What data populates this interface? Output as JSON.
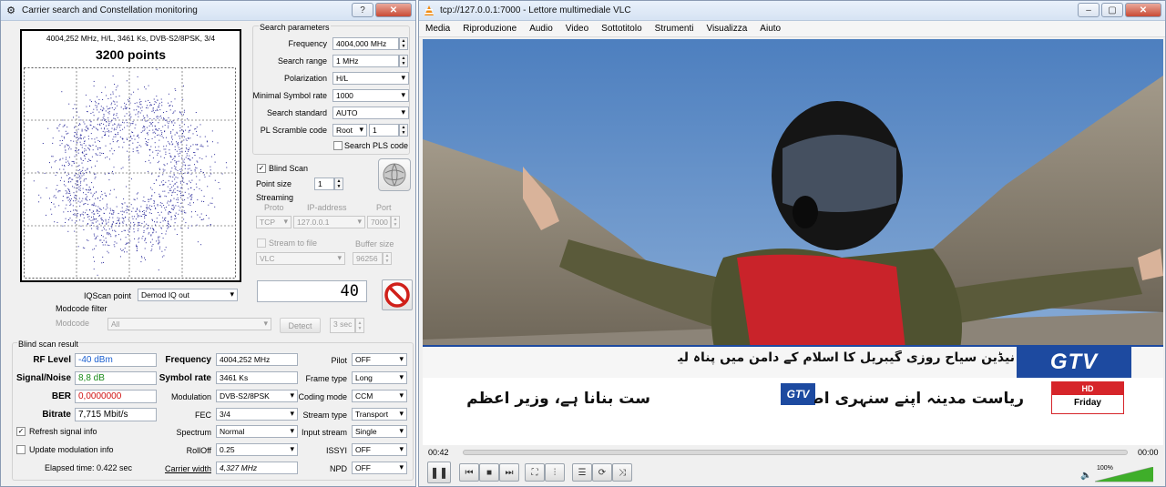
{
  "left_window": {
    "title": "Carrier search and Constellation monitoring",
    "help_btn": "?",
    "close_btn": "✕",
    "constellation": {
      "info": "4004,252 MHz, H/L, 3461 Ks, DVB-S2/8PSK, 3/4",
      "points_label": "3200 points"
    },
    "search_params": {
      "title": "Search parameters",
      "frequency_label": "Frequency",
      "frequency_value": "4004,000 MHz",
      "range_label": "Search range",
      "range_value": "1 MHz",
      "polarization_label": "Polarization",
      "polarization_value": "H/L",
      "min_sr_label": "Minimal Symbol rate",
      "min_sr_value": "1000",
      "standard_label": "Search standard",
      "standard_value": "AUTO",
      "pls_label": "PL Scramble code",
      "pls_mode": "Root",
      "pls_value": "1",
      "search_pls_label": "Search PLS code"
    },
    "blind_scan_label": "Blind Scan",
    "point_size_label": "Point size",
    "point_size_value": "1",
    "streaming": {
      "title": "Streaming",
      "proto_label": "Proto",
      "ip_label": "IP-address",
      "port_label": "Port",
      "proto_value": "TCP",
      "ip_value": "127.0.0.1",
      "port_value": "7000",
      "stream_to_file_label": "Stream to file",
      "buffer_label": "Buffer size",
      "player_value": "VLC",
      "buffer_value": "96256"
    },
    "iq_label": "IQScan point",
    "iq_value": "Demod IQ out",
    "counter_value": "40",
    "modcode": {
      "title": "Modcode filter",
      "label": "Modcode",
      "value": "All",
      "detect_label": "Detect",
      "timeout_value": "3 sec"
    },
    "result": {
      "title": "Blind scan result",
      "rf_label": "RF Level",
      "rf_value": "-40 dBm",
      "sn_label": "Signal/Noise",
      "sn_value": "8,8 dB",
      "ber_label": "BER",
      "ber_value": "0,0000000",
      "bitrate_label": "Bitrate",
      "bitrate_value": "7,715 Mbit/s",
      "freq_label": "Frequency",
      "freq_value": "4004,252 MHz",
      "sr_label": "Symbol rate",
      "sr_value": "3461 Ks",
      "mod_label": "Modulation",
      "mod_value": "DVB-S2/8PSK",
      "fec_label": "FEC",
      "fec_value": "3/4",
      "spectrum_label": "Spectrum",
      "spectrum_value": "Normal",
      "rolloff_label": "RollOff",
      "rolloff_value": "0.25",
      "cw_label": "Carrier width",
      "cw_value": "4,327 MHz",
      "pilot_label": "Pilot",
      "pilot_value": "OFF",
      "frame_label": "Frame type",
      "frame_value": "Long",
      "coding_label": "Coding mode",
      "coding_value": "CCM",
      "stream_label": "Stream type",
      "stream_value": "Transport",
      "input_label": "Input stream",
      "input_value": "Single",
      "issyi_label": "ISSYI",
      "issyi_value": "OFF",
      "npd_label": "NPD",
      "npd_value": "OFF"
    },
    "refresh_label": "Refresh signal info",
    "update_label": "Update modulation info",
    "elapsed": "Elapsed time: 0.422 sec"
  },
  "right_window": {
    "title": "tcp://127.0.0.1:7000 - Lettore multimediale VLC",
    "menu": [
      "Media",
      "Riproduzione",
      "Audio",
      "Video",
      "Sottotitolo",
      "Strumenti",
      "Visualizza",
      "Aiuto"
    ],
    "ticker_top": "نیڈین سیاح روزی گیبریل کا اسلام کے دامن میں پناہ لینے کا اعلان",
    "ticker_bottom_a": "ریاست مدینہ اپنے سنہری اصولوں کی بنیاد پر بے مثا",
    "ticker_bottom_b": "ست بنانا ہے، وزیر اعظم",
    "logo": "GTV",
    "logo_small": "GTV",
    "day": "Friday",
    "hd": "HD",
    "time_elapsed": "00:42",
    "time_total": "00:00",
    "volume": "100%",
    "volume_fraction": 1.0
  },
  "colors": {
    "rf": "#1a5fd0",
    "sn": "#1a8a1a",
    "ber": "#d01010",
    "ticker_blue": "#1d4aa0",
    "gtv_red": "#d6252a"
  }
}
